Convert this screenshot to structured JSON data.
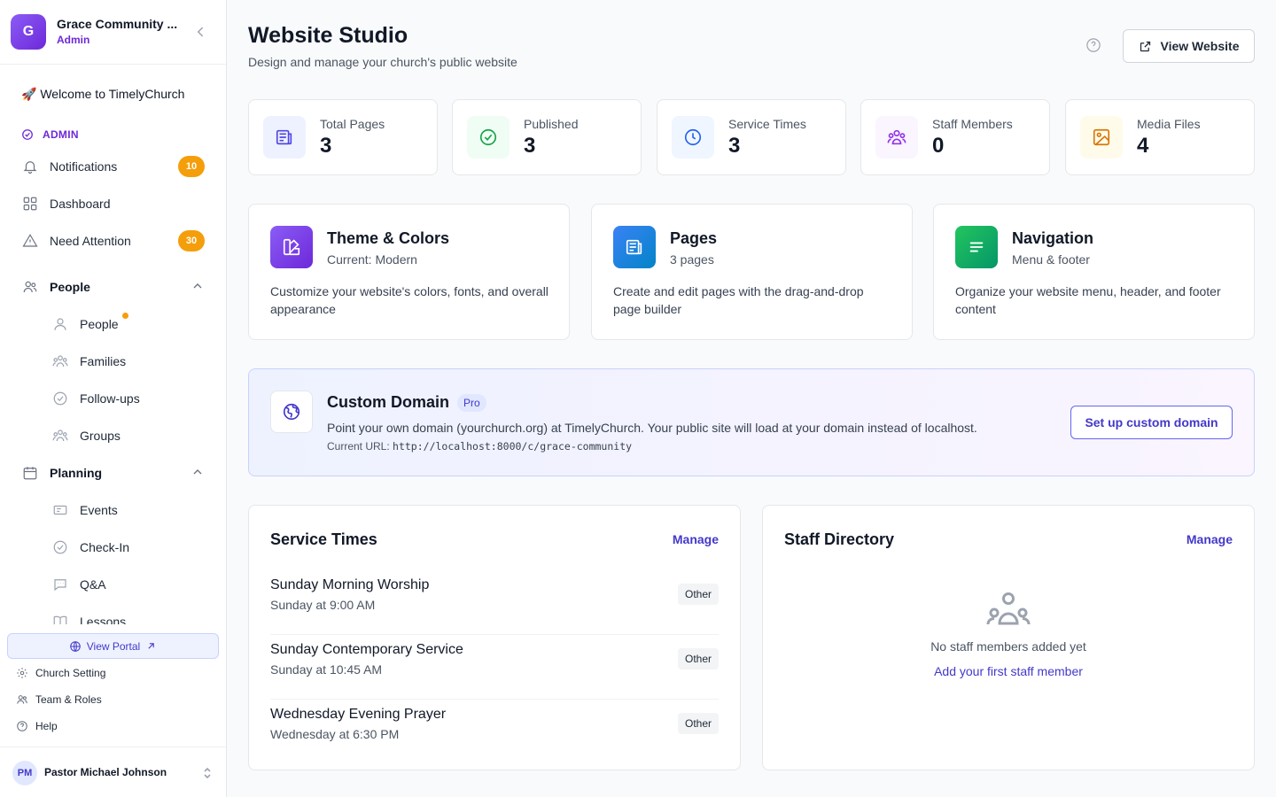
{
  "org": {
    "initial": "G",
    "name": "Grace Community ...",
    "role": "Admin"
  },
  "nav": {
    "welcome": "🚀 Welcome to TimelyChurch",
    "section_admin": "ADMIN",
    "notifications": {
      "label": "Notifications",
      "badge": "10"
    },
    "dashboard": "Dashboard",
    "need_attention": {
      "label": "Need Attention",
      "badge": "30"
    },
    "people_group": "People",
    "people": "People",
    "families": "Families",
    "followups": "Follow-ups",
    "groups": "Groups",
    "planning_group": "Planning",
    "events": "Events",
    "checkin": "Check-In",
    "qa": "Q&A",
    "lessons": "Lessons"
  },
  "sidebar_bottom": {
    "view_portal": "View Portal",
    "church_setting": "Church Setting",
    "team_roles": "Team & Roles",
    "help": "Help",
    "user_initials": "PM",
    "user_name": "Pastor Michael Johnson"
  },
  "header": {
    "title": "Website Studio",
    "subtitle": "Design and manage your church's public website",
    "view_website": "View Website"
  },
  "stats": [
    {
      "label": "Total Pages",
      "value": "3",
      "icon": "pages-icon",
      "color": "#4f46e5"
    },
    {
      "label": "Published",
      "value": "3",
      "icon": "check-circle-icon",
      "color": "#16a34a"
    },
    {
      "label": "Service Times",
      "value": "3",
      "icon": "clock-icon",
      "color": "#2563eb"
    },
    {
      "label": "Staff Members",
      "value": "0",
      "icon": "users-icon",
      "color": "#9333ea"
    },
    {
      "label": "Media Files",
      "value": "4",
      "icon": "image-icon",
      "color": "#d97706"
    }
  ],
  "features": [
    {
      "title": "Theme & Colors",
      "subtitle": "Current: Modern",
      "description": "Customize your website's colors, fonts, and overall appearance",
      "icon": "palette-icon"
    },
    {
      "title": "Pages",
      "subtitle": "3 pages",
      "description": "Create and edit pages with the drag-and-drop page builder",
      "icon": "pages-icon"
    },
    {
      "title": "Navigation",
      "subtitle": "Menu & footer",
      "description": "Organize your website menu, header, and footer content",
      "icon": "menu-icon"
    }
  ],
  "domain": {
    "title": "Custom Domain",
    "badge": "Pro",
    "description": "Point your own domain (yourchurch.org) at TimelyChurch. Your public site will load at your domain instead of localhost.",
    "current_label": "Current URL:",
    "current_url": "http://localhost:8000/c/grace-community",
    "button": "Set up custom domain"
  },
  "service_times": {
    "title": "Service Times",
    "manage": "Manage",
    "items": [
      {
        "name": "Sunday Morning Worship",
        "time": "Sunday at 9:00 AM",
        "tag": "Other"
      },
      {
        "name": "Sunday Contemporary Service",
        "time": "Sunday at 10:45 AM",
        "tag": "Other"
      },
      {
        "name": "Wednesday Evening Prayer",
        "time": "Wednesday at 6:30 PM",
        "tag": "Other"
      }
    ]
  },
  "staff": {
    "title": "Staff Directory",
    "manage": "Manage",
    "empty": "No staff members added yet",
    "add_link": "Add your first staff member"
  }
}
